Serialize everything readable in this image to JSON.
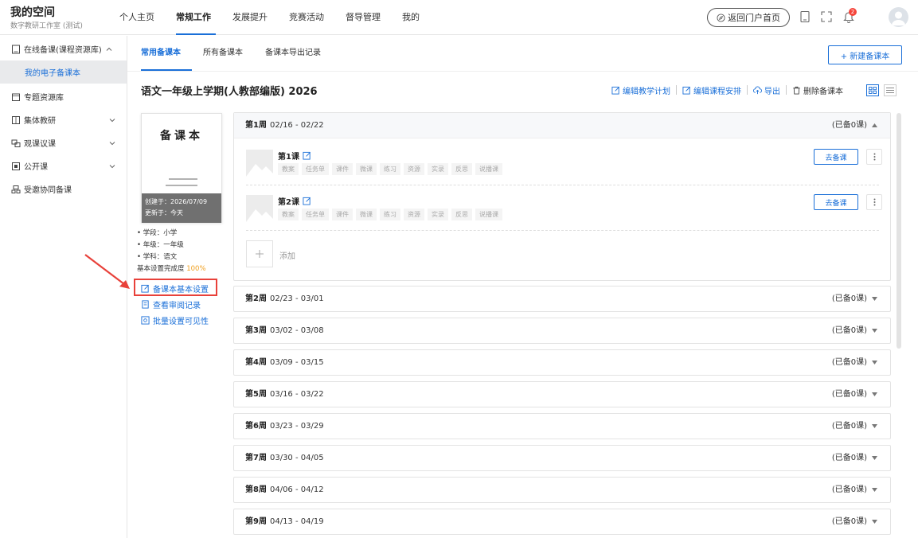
{
  "header": {
    "title": "我的空间",
    "subtitle": "数字教研工作室 (测试)",
    "nav": [
      "个人主页",
      "常规工作",
      "发展提升",
      "竞赛活动",
      "督导管理",
      "我的"
    ],
    "active_nav": "常规工作",
    "portal_label": "返回门户首页",
    "notification_count": "2",
    "accent_color": "#1a6fd8"
  },
  "sidebar": {
    "items": [
      {
        "label": "在线备课(课程资源库)",
        "icon": "book-icon",
        "expanded": true
      },
      {
        "label": "专题资源库",
        "icon": "folder-icon"
      },
      {
        "label": "集体教研",
        "icon": "group-icon",
        "expandable": true
      },
      {
        "label": "观课议课",
        "icon": "observe-icon",
        "expandable": true
      },
      {
        "label": "公开课",
        "icon": "class-icon",
        "expandable": true
      },
      {
        "label": "受邀协同备课",
        "icon": "collab-icon"
      }
    ],
    "sub_item": "我的电子备课本"
  },
  "tabs": [
    "常用备课本",
    "所有备课本",
    "备课本导出记录"
  ],
  "active_tab": "常用备课本",
  "new_button": "+ 新建备课本",
  "book": {
    "title": "语文一年级上学期(人教部编版) 2026",
    "actions": [
      "编辑教学计划",
      "编辑课程安排",
      "导出",
      "删除备课本"
    ],
    "cover_title": "备课本",
    "created": "创建于：2026/07/09",
    "updated": "更新于：今天",
    "info": {
      "stage": "• 学段：小学",
      "grade": "• 年级：一年级",
      "subject": "• 学科：语文",
      "completion_label": "基本设置完成度",
      "completion_value": "100%"
    },
    "links": [
      "备课本基本设置",
      "查看审阅记录",
      "批量设置可见性"
    ]
  },
  "weeks": [
    {
      "label": "第1周",
      "range": "02/16 - 02/22",
      "status": "(已备0课)",
      "expanded": true
    },
    {
      "label": "第2周",
      "range": "02/23 - 03/01",
      "status": "(已备0课)"
    },
    {
      "label": "第3周",
      "range": "03/02 - 03/08",
      "status": "(已备0课)"
    },
    {
      "label": "第4周",
      "range": "03/09 - 03/15",
      "status": "(已备0课)"
    },
    {
      "label": "第5周",
      "range": "03/16 - 03/22",
      "status": "(已备0课)"
    },
    {
      "label": "第6周",
      "range": "03/23 - 03/29",
      "status": "(已备0课)"
    },
    {
      "label": "第7周",
      "range": "03/30 - 04/05",
      "status": "(已备0课)"
    },
    {
      "label": "第8周",
      "range": "04/06 - 04/12",
      "status": "(已备0课)"
    },
    {
      "label": "第9周",
      "range": "04/13 - 04/19",
      "status": "(已备0课)"
    }
  ],
  "lessons": [
    {
      "name": "第1课",
      "tags": [
        "教案",
        "任务单",
        "课件",
        "微课",
        "练习",
        "资源",
        "实录",
        "反思",
        "说播课"
      ],
      "button": "去备课"
    },
    {
      "name": "第2课",
      "tags": [
        "教案",
        "任务单",
        "课件",
        "微课",
        "练习",
        "资源",
        "实录",
        "反思",
        "说播课"
      ],
      "button": "去备课"
    }
  ],
  "add_label": "添加",
  "highlight_color": "#e8413a"
}
